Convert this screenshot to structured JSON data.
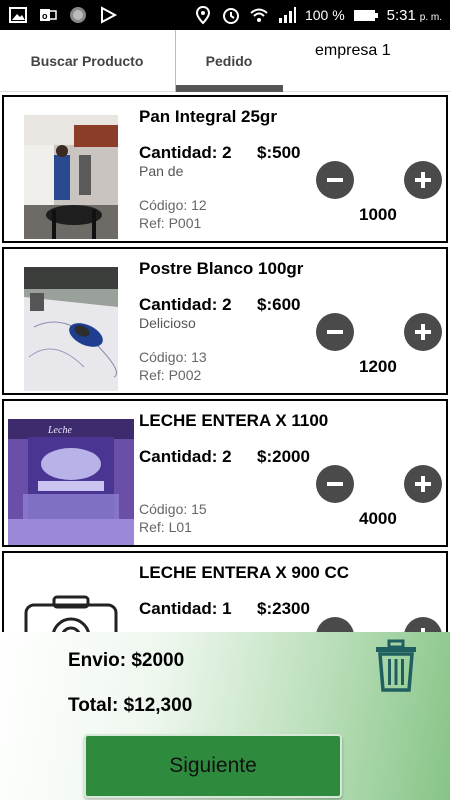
{
  "status_bar": {
    "battery": "100 %",
    "time": "5:31",
    "ampm": "p. m."
  },
  "tabs": [
    {
      "label": "Buscar Producto",
      "active": false
    },
    {
      "label": "Pedido",
      "active": true
    }
  ],
  "company": "empresa 1",
  "items": [
    {
      "name": "Pan Integral 25gr",
      "quantity": "Cantidad: 2",
      "price": "$:500",
      "description": "Pan de",
      "code": "Código: 12",
      "ref": "Ref: P001",
      "subtotal": "1000",
      "image": "kitchen-photo"
    },
    {
      "name": "Postre Blanco 100gr",
      "quantity": "Cantidad: 2",
      "price": "$:600",
      "description": "Delicioso",
      "code": "Código: 13",
      "ref": "Ref: P002",
      "subtotal": "1200",
      "image": "desk-mouse-photo"
    },
    {
      "name": "LECHE ENTERA X 1100",
      "quantity": "Cantidad: 2",
      "price": "$:2000",
      "description": "",
      "code": "Código: 15",
      "ref": "Ref: L01",
      "subtotal": "4000",
      "image": "milk-carton-photo"
    },
    {
      "name": "LECHE ENTERA X 900 CC",
      "quantity": "Cantidad: 1",
      "price": "$:2300",
      "description": "",
      "code": "",
      "ref": "",
      "subtotal": "",
      "image": "camera-placeholder-icon"
    }
  ],
  "summary": {
    "shipping": "Envio: $2000",
    "total": "Total: $12,300"
  },
  "next_button": "Siguiente",
  "colors": {
    "accent_green": "#2e8b3e",
    "circle_button": "#4a4a4a",
    "trash_icon": "#1f5f5f"
  }
}
